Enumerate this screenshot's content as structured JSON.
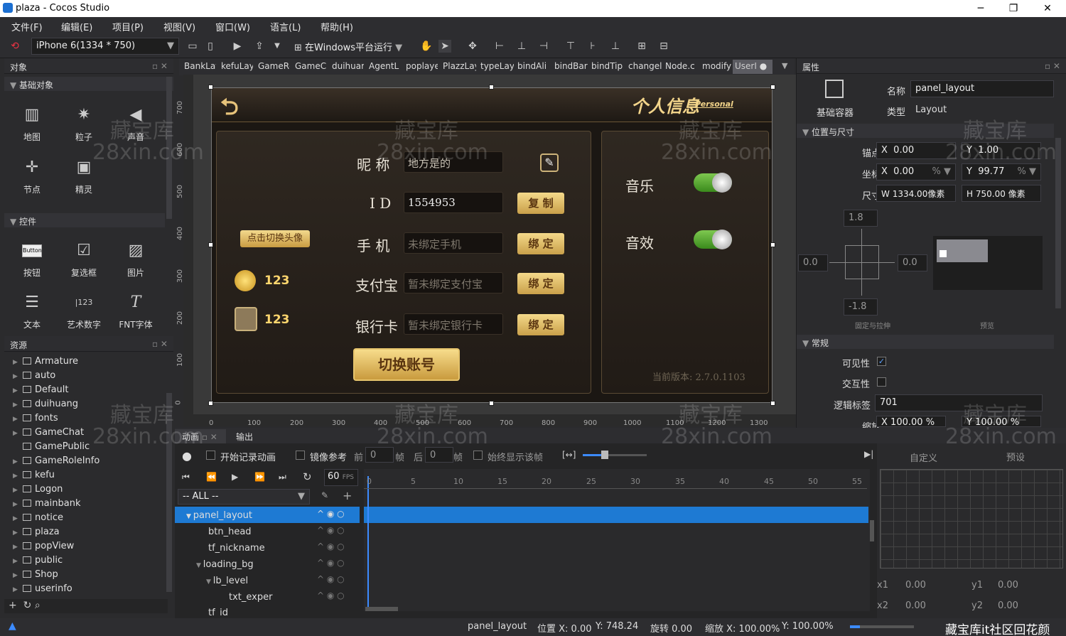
{
  "window": {
    "title": "plaza - Cocos Studio",
    "min": "─",
    "max": "❐",
    "close": "✕"
  },
  "menu": [
    "文件(F)",
    "编辑(E)",
    "项目(P)",
    "视图(V)",
    "窗口(W)",
    "语言(L)",
    "帮助(H)"
  ],
  "toolbar": {
    "device": "iPhone 6(1334 * 750)",
    "run_label": "在Windows平台运行"
  },
  "objects_panel": {
    "title": "对象",
    "basic_section": "基础对象",
    "basic_items": [
      "地图",
      "粒子",
      "声音",
      "节点",
      "精灵"
    ],
    "controls_section": "控件",
    "control_items": [
      "按钮",
      "复选框",
      "图片",
      "文本",
      "艺术数字",
      "FNT字体"
    ],
    "button_icon_text": "Button",
    "art_icon_text": "123"
  },
  "resources_panel": {
    "title": "资源",
    "folders": [
      "Armature",
      "auto",
      "Default",
      "duihuang",
      "fonts",
      "GameChat",
      "GamePublic",
      "GameRoleInfo",
      "kefu",
      "Logon",
      "mainbank",
      "notice",
      "plaza",
      "popView",
      "public",
      "Shop",
      "userinfo"
    ]
  },
  "tabs": [
    "BankLay",
    "kefuLay",
    "GameRc",
    "GameCl",
    "duihuar",
    "AgentL",
    "poplaye",
    "PlazzLay",
    "typeLay",
    "bindAli",
    "bindBar",
    "bindTip",
    "changel",
    "Node.c",
    "modify",
    "UserI"
  ],
  "canvas": {
    "v_ticks": [
      "700",
      "600",
      "500",
      "400",
      "300",
      "200",
      "100",
      "0"
    ],
    "h_ticks": [
      "0",
      "100",
      "200",
      "300",
      "400",
      "500",
      "600",
      "700",
      "800",
      "900",
      "1000",
      "1100",
      "1200",
      "1300"
    ],
    "game": {
      "header_title": "个人信息",
      "header_sub": "Personal",
      "nickname_label": "昵  称",
      "nickname_value": "地方是的",
      "id_label": "I  D",
      "id_value": "1554953",
      "copy_btn": "复 制",
      "phone_label": "手  机",
      "phone_placeholder": "未绑定手机",
      "bind_btn": "绑 定",
      "alipay_label": "支付宝",
      "alipay_placeholder": "暂未绑定支付宝",
      "bank_label": "银行卡",
      "bank_placeholder": "暂未绑定银行卡",
      "switch_avatar": "点击切换头像",
      "gold": "123",
      "bank_amount": "123",
      "switch_account": "切换账号",
      "music_label": "音乐",
      "sfx_label": "音效",
      "version": "当前版本: 2.7.0.1103"
    }
  },
  "properties": {
    "title": "属性",
    "container_label": "基础容器",
    "name_label": "名称",
    "name_value": "panel_layout",
    "type_label": "类型",
    "type_value": "Layout",
    "pos_size_section": "位置与尺寸",
    "anchor_label": "锚点",
    "anchor_x": "0.00",
    "anchor_y": "1.00",
    "pos_label": "坐标",
    "pos_x": "0.00",
    "pos_y": "99.77",
    "pct": "%",
    "size_label": "尺寸",
    "size_w": "1334.00像素",
    "size_h": "750.00 像素",
    "x": "X",
    "y": "Y",
    "w": "W",
    "h": "H",
    "margin_top": "1.8",
    "margin_left": "0.0",
    "margin_right": "0.0",
    "margin_bottom": "-1.8",
    "stretch_label": "固定与拉伸",
    "preview_label": "预览",
    "general_section": "常规",
    "visible_label": "可见性",
    "interactive_label": "交互性",
    "tag_label": "逻辑标签",
    "tag_value": "701",
    "scale_label": "缩放",
    "scale_x": "100.00",
    "scale_y": "100.00"
  },
  "animation": {
    "tab_anim": "动画",
    "tab_output": "输出",
    "record_label": "开始记录动画",
    "mirror_label": "镜像参考",
    "before_label": "前",
    "before_val": "0",
    "frame_label": "帧",
    "after_label": "后",
    "after_val": "0",
    "always_show_label": "始终显示该帧",
    "fps_value": "60",
    "fps_unit": "FPS",
    "filter": "-- ALL --",
    "ticks": [
      "0",
      "5",
      "10",
      "15",
      "20",
      "25",
      "30",
      "35",
      "40",
      "45",
      "50",
      "55"
    ],
    "nodes": [
      "panel_layout",
      "btn_head",
      "tf_nickname",
      "loading_bg",
      "lb_level",
      "txt_exper",
      "tf_id"
    ],
    "custom_label": "自定义",
    "preset_label": "预设",
    "x1_label": "x1",
    "x1": "0.00",
    "y1_label": "y1",
    "y1": "0.00",
    "x2_label": "x2",
    "x2": "0.00",
    "y2_label": "y2",
    "y2": "0.00"
  },
  "status": {
    "node": "panel_layout",
    "pos_x": "位置 X: 0.00",
    "pos_y": "Y: 748.24",
    "rotation": "旋转 0.00",
    "scale_x": "缩放 X: 100.00%",
    "scale_y": "Y: 100.00%",
    "watermark": "藏宝库it社区回花颜"
  },
  "watermark": {
    "cn": "藏宝库",
    "en": "28xin.com"
  }
}
